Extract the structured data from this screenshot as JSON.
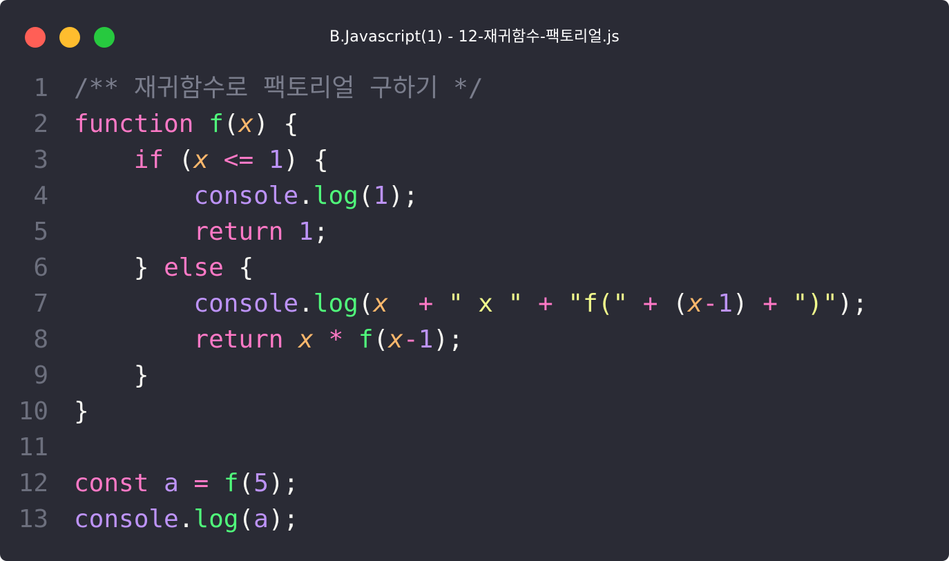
{
  "window": {
    "title": "B.Javascript(1) - 12-재귀함수-팩토리얼.js",
    "traffic_lights": [
      {
        "name": "close",
        "color": "#ff5f56"
      },
      {
        "name": "minimize",
        "color": "#ffbd2e"
      },
      {
        "name": "maximize",
        "color": "#27c93f"
      }
    ]
  },
  "theme": {
    "background": "#2a2b35",
    "line_number": "#6c6f7d",
    "comment": "#7a7d8c",
    "keyword": "#ff79c6",
    "function": "#50fa7b",
    "parameter": "#ffb86c",
    "number": "#bd93f9",
    "string": "#f1fa8c",
    "text": "#f8f8f2"
  },
  "code": {
    "lines": [
      {
        "number": "1",
        "tokens": [
          {
            "t": "/** 재귀함수로 팩토리얼 구하기 */",
            "k": "comment"
          }
        ]
      },
      {
        "number": "2",
        "tokens": [
          {
            "t": "function",
            "k": "keyword"
          },
          {
            "t": " ",
            "k": "plain"
          },
          {
            "t": "f",
            "k": "func"
          },
          {
            "t": "(",
            "k": "punct"
          },
          {
            "t": "x",
            "k": "param"
          },
          {
            "t": ") {",
            "k": "punct"
          }
        ]
      },
      {
        "number": "3",
        "tokens": [
          {
            "t": "    ",
            "k": "plain"
          },
          {
            "t": "if",
            "k": "keyword"
          },
          {
            "t": " (",
            "k": "punct"
          },
          {
            "t": "x",
            "k": "param"
          },
          {
            "t": " ",
            "k": "plain"
          },
          {
            "t": "<=",
            "k": "op"
          },
          {
            "t": " ",
            "k": "plain"
          },
          {
            "t": "1",
            "k": "number"
          },
          {
            "t": ") {",
            "k": "punct"
          }
        ]
      },
      {
        "number": "4",
        "tokens": [
          {
            "t": "        ",
            "k": "plain"
          },
          {
            "t": "console",
            "k": "object"
          },
          {
            "t": ".",
            "k": "punct"
          },
          {
            "t": "log",
            "k": "func"
          },
          {
            "t": "(",
            "k": "punct"
          },
          {
            "t": "1",
            "k": "number"
          },
          {
            "t": ");",
            "k": "punct"
          }
        ]
      },
      {
        "number": "5",
        "tokens": [
          {
            "t": "        ",
            "k": "plain"
          },
          {
            "t": "return",
            "k": "keyword"
          },
          {
            "t": " ",
            "k": "plain"
          },
          {
            "t": "1",
            "k": "number"
          },
          {
            "t": ";",
            "k": "punct"
          }
        ]
      },
      {
        "number": "6",
        "tokens": [
          {
            "t": "    ",
            "k": "plain"
          },
          {
            "t": "} ",
            "k": "punct"
          },
          {
            "t": "else",
            "k": "keyword"
          },
          {
            "t": " {",
            "k": "punct"
          }
        ]
      },
      {
        "number": "7",
        "tokens": [
          {
            "t": "        ",
            "k": "plain"
          },
          {
            "t": "console",
            "k": "object"
          },
          {
            "t": ".",
            "k": "punct"
          },
          {
            "t": "log",
            "k": "func"
          },
          {
            "t": "(",
            "k": "punct"
          },
          {
            "t": "x",
            "k": "param"
          },
          {
            "t": "  ",
            "k": "plain"
          },
          {
            "t": "+",
            "k": "op"
          },
          {
            "t": " ",
            "k": "plain"
          },
          {
            "t": "\" x \"",
            "k": "string"
          },
          {
            "t": " ",
            "k": "plain"
          },
          {
            "t": "+",
            "k": "op"
          },
          {
            "t": " ",
            "k": "plain"
          },
          {
            "t": "\"f(\"",
            "k": "string"
          },
          {
            "t": " ",
            "k": "plain"
          },
          {
            "t": "+",
            "k": "op"
          },
          {
            "t": " (",
            "k": "punct"
          },
          {
            "t": "x",
            "k": "param"
          },
          {
            "t": "-",
            "k": "op"
          },
          {
            "t": "1",
            "k": "number"
          },
          {
            "t": ") ",
            "k": "punct"
          },
          {
            "t": "+",
            "k": "op"
          },
          {
            "t": " ",
            "k": "plain"
          },
          {
            "t": "\")\"",
            "k": "string"
          },
          {
            "t": ");",
            "k": "punct"
          }
        ]
      },
      {
        "number": "8",
        "tokens": [
          {
            "t": "        ",
            "k": "plain"
          },
          {
            "t": "return",
            "k": "keyword"
          },
          {
            "t": " ",
            "k": "plain"
          },
          {
            "t": "x",
            "k": "param"
          },
          {
            "t": " ",
            "k": "plain"
          },
          {
            "t": "*",
            "k": "op"
          },
          {
            "t": " ",
            "k": "plain"
          },
          {
            "t": "f",
            "k": "func"
          },
          {
            "t": "(",
            "k": "punct"
          },
          {
            "t": "x",
            "k": "param"
          },
          {
            "t": "-",
            "k": "op"
          },
          {
            "t": "1",
            "k": "number"
          },
          {
            "t": ");",
            "k": "punct"
          }
        ]
      },
      {
        "number": "9",
        "tokens": [
          {
            "t": "    }",
            "k": "punct"
          }
        ]
      },
      {
        "number": "10",
        "tokens": [
          {
            "t": "}",
            "k": "punct"
          }
        ]
      },
      {
        "number": "11",
        "tokens": []
      },
      {
        "number": "12",
        "tokens": [
          {
            "t": "const",
            "k": "keyword"
          },
          {
            "t": " ",
            "k": "plain"
          },
          {
            "t": "a",
            "k": "var"
          },
          {
            "t": " ",
            "k": "plain"
          },
          {
            "t": "=",
            "k": "op"
          },
          {
            "t": " ",
            "k": "plain"
          },
          {
            "t": "f",
            "k": "func"
          },
          {
            "t": "(",
            "k": "punct"
          },
          {
            "t": "5",
            "k": "number"
          },
          {
            "t": ");",
            "k": "punct"
          }
        ]
      },
      {
        "number": "13",
        "tokens": [
          {
            "t": "console",
            "k": "object"
          },
          {
            "t": ".",
            "k": "punct"
          },
          {
            "t": "log",
            "k": "func"
          },
          {
            "t": "(",
            "k": "punct"
          },
          {
            "t": "a",
            "k": "var"
          },
          {
            "t": ");",
            "k": "punct"
          }
        ]
      }
    ]
  }
}
